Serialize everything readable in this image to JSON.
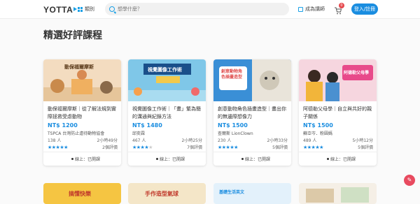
{
  "header": {
    "logo": "YOTTA",
    "category_label": "類別",
    "search_placeholder": "想學什麼？",
    "teacher_label": "成為講師",
    "cart_count": "0",
    "login_label": "登入/註冊"
  },
  "section_title": "精選好評課程",
  "cards": [
    {
      "thumb_text": "動保福爾摩斯",
      "title": "動保福爾摩斯｜從了解法規到實際拯救受虐動物",
      "price": "NT$ 1200",
      "author": "TSPCA 台灣防止虐待動物協會",
      "students": "138 人",
      "duration": "2小時49分",
      "stars": 5,
      "reviews": "2個評價",
      "status": "線上：已開課"
    },
    {
      "thumb_text": "視覺圖像工作術",
      "title": "視覺圖像工作術｜「畫」繁為簡的溝通與紀錄方法",
      "price": "NT$ 1480",
      "author": "邱奕霖",
      "students": "467 人",
      "duration": "2小時25分",
      "stars": 4,
      "reviews": "7個評價",
      "status": "線上：已開課"
    },
    {
      "thumb_text": "創意動物角色插畫造型",
      "title": "創意動物角色插畫造型｜畫出你的無邊際想像力",
      "price": "NT$ 1500",
      "author": "查爾斯 LionClown",
      "students": "230 人",
      "duration": "2小時33分",
      "stars": 5,
      "reviews": "5個評價",
      "status": "線上：已開課"
    },
    {
      "thumb_text": "阿德勒父母學",
      "title": "阿德勒父母學｜自立與共好的親子關係",
      "price": "NT$ 1500",
      "author": "蘇亞岑．粉圓媽",
      "students": "489 人",
      "duration": "5小時12分",
      "stars": 5,
      "reviews": "5個評價",
      "status": "線上：已開課"
    }
  ],
  "bottom_cards": [
    {
      "thumb_text": "搞懂快樂"
    },
    {
      "thumb_text": "手作造型氣球"
    },
    {
      "thumb_text": "基礎生活英文"
    },
    {
      "thumb_text": ""
    }
  ],
  "colors": {
    "accent": "#1a8de0",
    "badge": "#e5484d",
    "fab": "#e84a5f"
  },
  "icons": [
    "grid-icon",
    "search-icon",
    "teacher-icon",
    "cart-icon",
    "user-icon",
    "clock-icon",
    "pen-icon"
  ]
}
